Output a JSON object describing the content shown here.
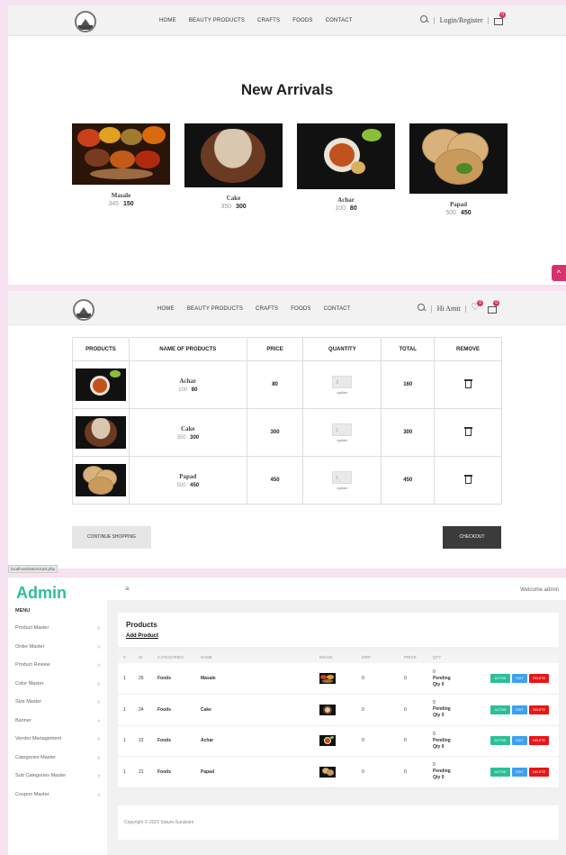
{
  "nav": {
    "items": [
      "HOME",
      "BEAUTY PRODUCTS",
      "CRAFTS",
      "FOODS",
      "CONTACT"
    ],
    "login": "Login/Register",
    "greeting": "Hi Amit",
    "wishlist_count": "0",
    "cart_count": "0"
  },
  "arrivals": {
    "title": "New Arrivals",
    "products": [
      {
        "name": "Masale",
        "old_price": "345",
        "price": "150"
      },
      {
        "name": "Cake",
        "old_price": "350",
        "price": "300"
      },
      {
        "name": "Achar",
        "old_price": "100",
        "price": "80"
      },
      {
        "name": "Papad",
        "old_price": "500",
        "price": "450"
      }
    ]
  },
  "cart": {
    "headers": [
      "PRODUCTS",
      "NAME OF PRODUCTS",
      "PRICE",
      "QUANTITY",
      "TOTAL",
      "REMOVE"
    ],
    "rows": [
      {
        "name": "Achar",
        "old_price": "100",
        "price": "80",
        "unit_price": "80",
        "qty": "2",
        "update": "update",
        "total": "160"
      },
      {
        "name": "Cake",
        "old_price": "350",
        "price": "300",
        "unit_price": "300",
        "qty": "1",
        "update": "update",
        "total": "300"
      },
      {
        "name": "Papad",
        "old_price": "500",
        "price": "450",
        "unit_price": "450",
        "qty": "1",
        "update": "update",
        "total": "450"
      }
    ],
    "continue_label": "CONTINUE SHOPPING",
    "checkout_label": "CHECKOUT",
    "status_url": "localhost/saturn/cart.php"
  },
  "admin": {
    "logo": "Admin",
    "menu_heading": "MENU",
    "sidebar": [
      "Product Master",
      "Order Master",
      "Product Review",
      "Color Master",
      "Size Master",
      "Banner",
      "Vendor Management",
      "Categories Master",
      "Sub Categories Master",
      "Coupon Master"
    ],
    "hamburger": "≡",
    "welcome": "Welcome admin",
    "section_title": "Products",
    "add_link": "Add Product",
    "headers": [
      "#",
      "ID",
      "CATEGORIES",
      "NAME",
      "IMAGE",
      "MRP",
      "PRICE",
      "QTY",
      ""
    ],
    "rows": [
      {
        "n": "1",
        "id": "25",
        "category": "Foods",
        "name": "Masale",
        "mrp": "0",
        "price": "0",
        "qty": "0",
        "pending": "Pending",
        "qty_line": "Qty 0"
      },
      {
        "n": "1",
        "id": "24",
        "category": "Foods",
        "name": "Cake",
        "mrp": "0",
        "price": "0",
        "qty": "0",
        "pending": "Pending",
        "qty_line": "Qty 0"
      },
      {
        "n": "1",
        "id": "22",
        "category": "Foods",
        "name": "Achar",
        "mrp": "0",
        "price": "0",
        "qty": "0",
        "pending": "Pending",
        "qty_line": "Qty 0"
      },
      {
        "n": "1",
        "id": "21",
        "category": "Foods",
        "name": "Papad",
        "mrp": "0",
        "price": "0",
        "qty": "0",
        "pending": "Pending",
        "qty_line": "Qty 0"
      }
    ],
    "btn_active": "ACTIVE",
    "btn_edit": "EDIT",
    "btn_delete": "DELETE",
    "copyright": "Copyright © 2021 Saturn-Sanjivani"
  },
  "colors": {
    "accent": "#d6336c",
    "admin_green": "#2bbf98",
    "edit_blue": "#3da0f0",
    "delete_red": "#e81616"
  }
}
